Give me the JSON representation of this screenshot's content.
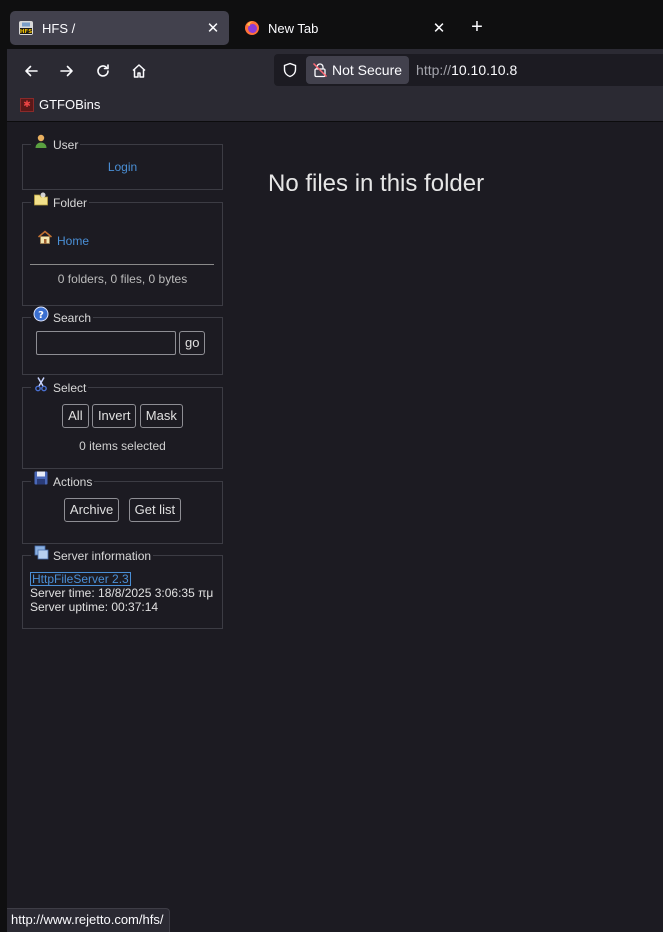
{
  "tabs": [
    {
      "title": "HFS /",
      "active": true,
      "icon": "hfs-icon"
    },
    {
      "title": "New Tab",
      "active": false,
      "icon": "firefox-icon"
    }
  ],
  "navbar": {
    "not_secure_label": "Not Secure",
    "url_protocol": "http://",
    "url_host": "10.10.10.8"
  },
  "bookmarks": [
    {
      "label": "GTFOBins"
    }
  ],
  "sidebar": {
    "user": {
      "legend": "User",
      "login_label": "Login"
    },
    "folder": {
      "legend": "Folder",
      "home_label": "Home",
      "summary": "0 folders, 0 files, 0 bytes"
    },
    "search": {
      "legend": "Search",
      "go_label": "go",
      "value": ""
    },
    "select": {
      "legend": "Select",
      "all_label": "All",
      "invert_label": "Invert",
      "mask_label": "Mask",
      "selected_text": "0 items selected"
    },
    "actions": {
      "legend": "Actions",
      "archive_label": "Archive",
      "getlist_label": "Get list"
    },
    "server": {
      "legend": "Server information",
      "version_link": "HttpFileServer 2.3",
      "server_time": "Server time: 18/8/2025 3:06:35 πμ",
      "server_uptime": "Server uptime: 00:37:14"
    }
  },
  "main": {
    "message": "No files in this folder"
  },
  "statusbar": {
    "text": "http://www.rejetto.com/hfs/"
  },
  "colors": {
    "link": "#4a8fd6",
    "background": "#1c1b22",
    "toolbar": "#2b2a33"
  }
}
